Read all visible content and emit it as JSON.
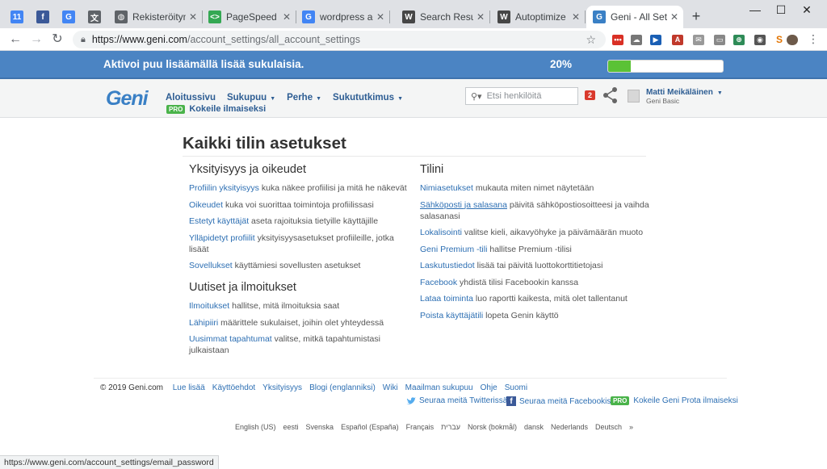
{
  "browser": {
    "tabs": [
      {
        "title": "",
        "icon": "calendar-icon",
        "fav_text": "11",
        "fav_color": "#4285f4",
        "pinned": true
      },
      {
        "title": "",
        "icon": "facebook-icon",
        "fav_text": "f",
        "fav_color": "#3b5998",
        "pinned": true
      },
      {
        "title": "",
        "icon": "google-icon",
        "fav_text": "G",
        "fav_color": "#4285f4",
        "pinned": true
      },
      {
        "title": "",
        "icon": "translate-icon",
        "fav_text": "文",
        "fav_color": "#5f6368",
        "pinned": true
      },
      {
        "title": "Rekisteröitymi",
        "icon": "globe-icon",
        "fav_text": "◍",
        "fav_color": "#5f6368"
      },
      {
        "title": "PageSpeed Insi",
        "icon": "pagespeed-icon",
        "fav_text": "<>",
        "fav_color": "#34a853"
      },
      {
        "title": "wordpress add",
        "icon": "google-icon",
        "fav_text": "G",
        "fav_color": "#4285f4"
      },
      {
        "title": "Search Results",
        "icon": "wordpress-icon",
        "fav_text": "W",
        "fav_color": "#464646"
      },
      {
        "title": "Autoptimize – W",
        "icon": "wordpress-icon",
        "fav_text": "W",
        "fav_color": "#464646"
      },
      {
        "title": "Geni - All Settin",
        "icon": "geni-icon",
        "fav_text": "G",
        "fav_color": "#3a80c5",
        "active": true
      }
    ],
    "url_host": "https://www.geni.com",
    "url_path": "/account_settings/all_account_settings",
    "status_url": "https://www.geni.com/account_settings/email_password"
  },
  "banner": {
    "message": "Aktivoi puu lisäämällä lisää sukulaisia.",
    "percent_label": "20%",
    "progress": 0.2,
    "fill_color": "#5bc236"
  },
  "header": {
    "logo": "Geni",
    "nav": [
      "Aloitussivu",
      "Sukupuu",
      "Perhe",
      "Sukututkimus"
    ],
    "pro_badge": "PRO",
    "pro_link": "Kokeile ilmaiseksi",
    "search_placeholder": "Etsi henkilöitä",
    "notification_count": "2",
    "user_name": "Matti Meikäläinen",
    "user_plan": "Geni Basic"
  },
  "main": {
    "title": "Kaikki tilin asetukset",
    "left": [
      {
        "section": "Yksityisyys ja oikeudet",
        "items": [
          {
            "link": "Profiilin yksityisyys",
            "desc": "kuka näkee profiilisi ja mitä he näkevät"
          },
          {
            "link": "Oikeudet",
            "desc": "kuka voi suorittaa toimintoja profiilissasi"
          },
          {
            "link": "Estetyt käyttäjät",
            "desc": "aseta rajoituksia tietyille käyttäjille"
          },
          {
            "link": "Ylläpidetyt profiilit",
            "desc": "yksityisyysasetukset profiileille, jotka lisäät"
          },
          {
            "link": "Sovellukset",
            "desc": "käyttämiesi sovellusten asetukset"
          }
        ]
      },
      {
        "section": "Uutiset ja ilmoitukset",
        "items": [
          {
            "link": "Ilmoitukset",
            "desc": "hallitse, mitä ilmoituksia saat"
          },
          {
            "link": "Lähipiiri",
            "desc": "määrittele sukulaiset, joihin olet yhteydessä"
          },
          {
            "link": "Uusimmat tapahtumat",
            "desc": "valitse, mitkä tapahtumistasi julkaistaan"
          }
        ]
      }
    ],
    "right": {
      "section": "Tilini",
      "items": [
        {
          "link": "Nimiasetukset",
          "desc": "mukauta miten nimet näytetään"
        },
        {
          "link": "Sähköposti ja salasana",
          "desc": "päivitä sähköpostiosoitteesi ja vaihda salasanasi",
          "hover": true
        },
        {
          "link": "Lokalisointi",
          "desc": "valitse kieli, aikavyöhyke ja päivämäärän muoto"
        },
        {
          "link": "Geni Premium -tili",
          "desc": "hallitse Premium -tilisi"
        },
        {
          "link": "Laskutustiedot",
          "desc": "lisää tai päivitä luottokorttitietojasi"
        },
        {
          "link": "Facebook",
          "desc": "yhdistä tilisi Facebookin kanssa"
        },
        {
          "link": "Lataa toiminta",
          "desc": "luo raportti kaikesta, mitä olet tallentanut"
        },
        {
          "link": "Poista käyttäjätili",
          "desc": "lopeta Genin käyttö"
        }
      ]
    }
  },
  "footer": {
    "copyright": "© 2019 Geni.com",
    "links": [
      "Lue lisää",
      "Käyttöehdot",
      "Yksityisyys",
      "Blogi (englanniksi)",
      "Wiki",
      "Maailman sukupuu",
      "Ohje",
      "Suomi"
    ],
    "twitter": "Seuraa meitä Twitterissä",
    "facebook": "Seuraa meitä Facebookissa",
    "pro_badge": "PRO",
    "pro": "Kokeile Geni Prota ilmaiseksi",
    "languages": [
      "English (US)",
      "eesti",
      "Svenska",
      "Español (España)",
      "Français",
      "עברית",
      "Norsk (bokmål)",
      "dansk",
      "Nederlands",
      "Deutsch",
      "»"
    ]
  }
}
